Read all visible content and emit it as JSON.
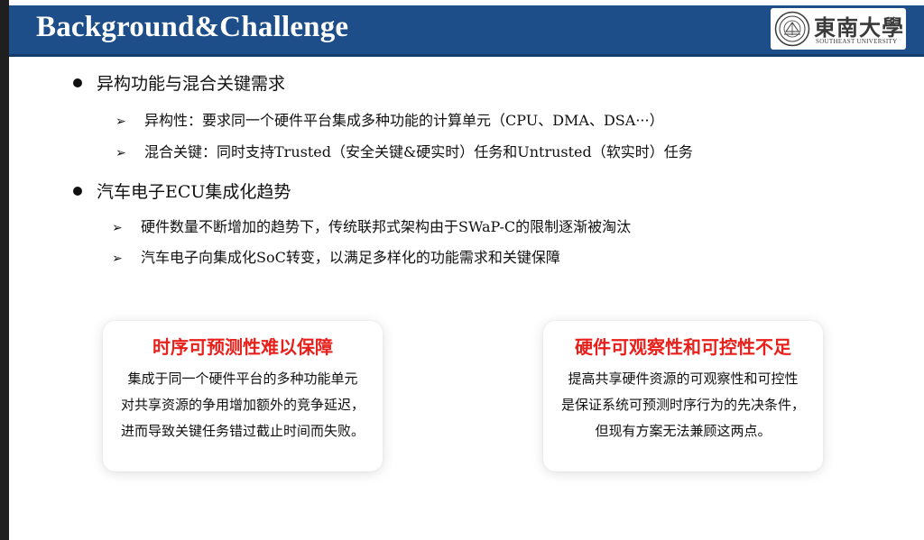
{
  "slide": {
    "title": "Background&Challenge",
    "logo": {
      "chinese_name": "東南大學",
      "english_name": "SOUTHEAST UNIVERSITY"
    },
    "sections": [
      {
        "heading": "异构功能与混合关键需求",
        "items": [
          "异构性：要求同一个硬件平台集成多种功能的计算单元（CPU、DMA、DSA···）",
          "混合关键：同时支持Trusted（安全关键&硬实时）任务和Untrusted（软实时）任务"
        ]
      },
      {
        "heading": "汽车电子ECU集成化趋势",
        "items": [
          "硬件数量不断增加的趋势下，传统联邦式架构由于SWaP-C的限制逐渐被淘汰",
          "汽车电子向集成化SoC转变，以满足多样化的功能需求和关键保障"
        ]
      }
    ],
    "cards": [
      {
        "title": "时序可预测性难以保障",
        "lines": [
          "集成于同一个硬件平台的多种功能单元",
          "对共享资源的争用增加额外的竞争延迟，",
          "进而导致关键任务错过截止时间而失败。"
        ]
      },
      {
        "title": "硬件可观察性和可控性不足",
        "lines": [
          "提高共享硬件资源的可观察性和可控性",
          "是保证系统可预测时序行为的先决条件，",
          "但现有方案无法兼顾这两点。"
        ]
      }
    ]
  },
  "colors": {
    "title_bar": "#1d4e89",
    "card_title": "#e8201b",
    "text": "#111111"
  },
  "icons": {
    "main_bullet": "filled-circle",
    "sub_bullet": "arrowhead-right",
    "logo_seal": "university-seal"
  }
}
